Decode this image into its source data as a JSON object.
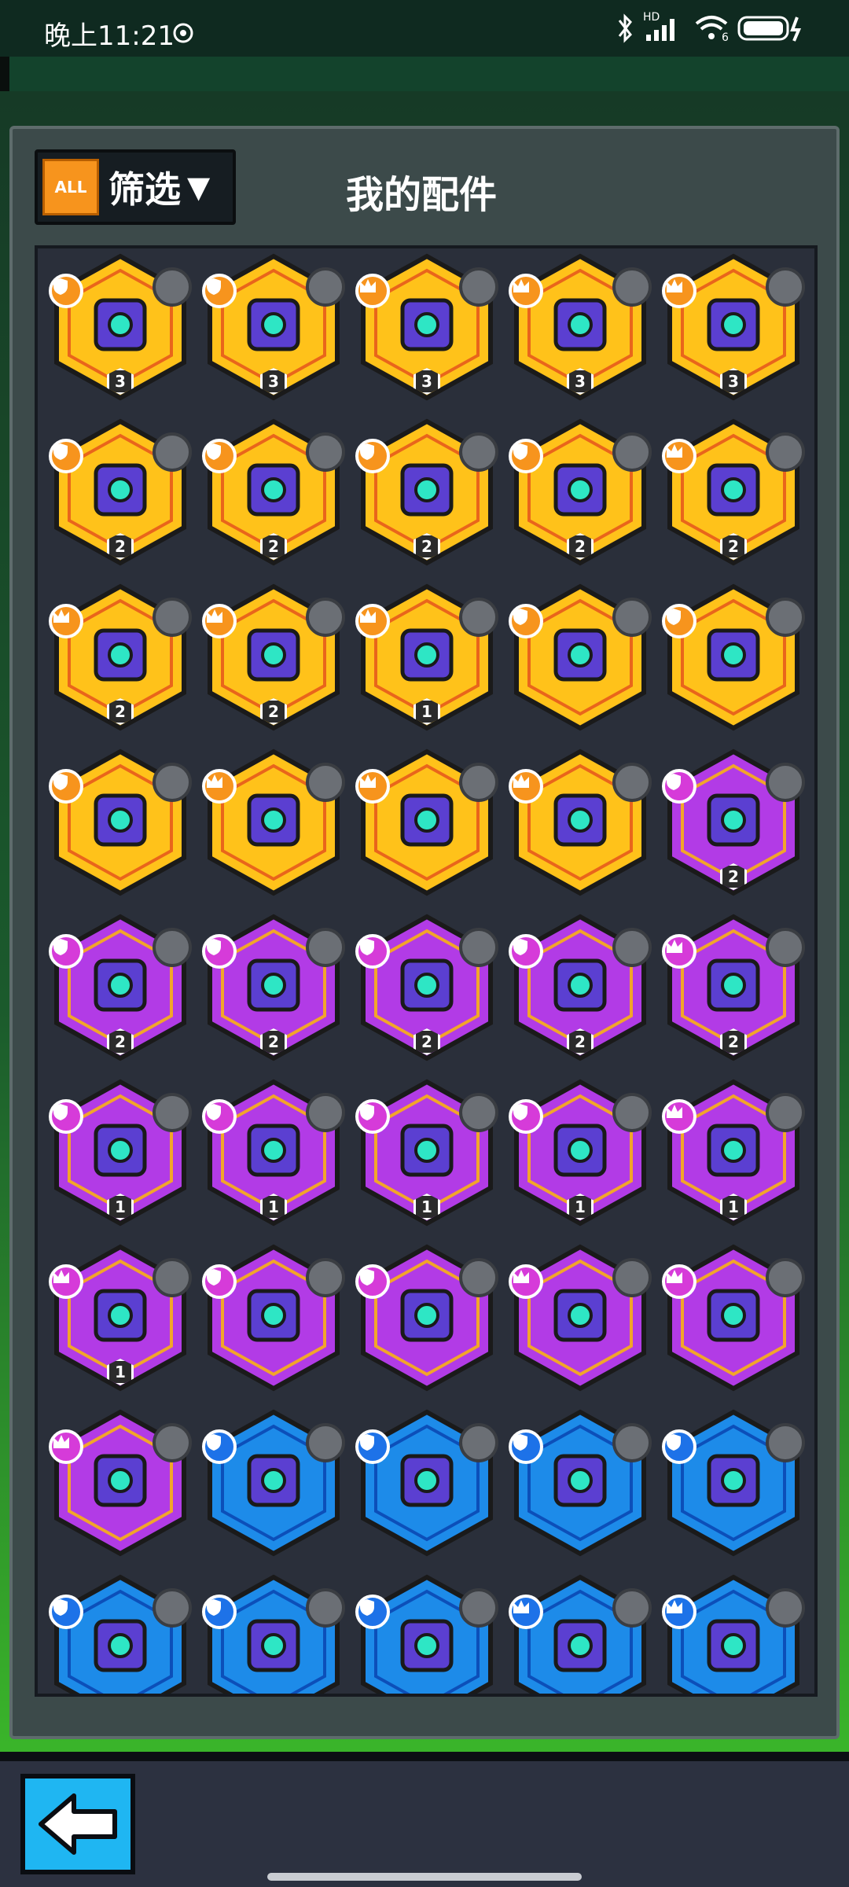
{
  "status_bar": {
    "time": "晚上11:21",
    "network": "HD",
    "wifi_label": "6"
  },
  "header": {
    "all_label": "ALL",
    "filter_label": "筛选",
    "filter_arrow": "▼",
    "title": "我的配件"
  },
  "colors": {
    "legendary": "#ffc21a",
    "legendary_border": "#e9651b",
    "epic": "#b23be6",
    "epic_border": "#f2a52a",
    "rare": "#1d8be9",
    "rare_border": "#0c4fb9"
  },
  "grid": {
    "rows": [
      [
        {
          "rarity": "legendary",
          "type": "shield",
          "level": "3"
        },
        {
          "rarity": "legendary",
          "type": "shield",
          "level": "3"
        },
        {
          "rarity": "legendary",
          "type": "crown",
          "level": "3"
        },
        {
          "rarity": "legendary",
          "type": "crown",
          "level": "3"
        },
        {
          "rarity": "legendary",
          "type": "crown",
          "level": "3"
        }
      ],
      [
        {
          "rarity": "legendary",
          "type": "shield",
          "level": "2"
        },
        {
          "rarity": "legendary",
          "type": "shield",
          "level": "2"
        },
        {
          "rarity": "legendary",
          "type": "shield",
          "level": "2"
        },
        {
          "rarity": "legendary",
          "type": "shield",
          "level": "2"
        },
        {
          "rarity": "legendary",
          "type": "crown",
          "level": "2"
        }
      ],
      [
        {
          "rarity": "legendary",
          "type": "crown",
          "level": "2"
        },
        {
          "rarity": "legendary",
          "type": "crown",
          "level": "2"
        },
        {
          "rarity": "legendary",
          "type": "crown",
          "level": "1"
        },
        {
          "rarity": "legendary",
          "type": "shield",
          "level": ""
        },
        {
          "rarity": "legendary",
          "type": "shield",
          "level": ""
        }
      ],
      [
        {
          "rarity": "legendary",
          "type": "shield",
          "level": ""
        },
        {
          "rarity": "legendary",
          "type": "crown",
          "level": ""
        },
        {
          "rarity": "legendary",
          "type": "crown",
          "level": ""
        },
        {
          "rarity": "legendary",
          "type": "crown",
          "level": ""
        },
        {
          "rarity": "epic",
          "type": "shield",
          "level": "2"
        }
      ],
      [
        {
          "rarity": "epic",
          "type": "shield",
          "level": "2"
        },
        {
          "rarity": "epic",
          "type": "shield",
          "level": "2"
        },
        {
          "rarity": "epic",
          "type": "shield",
          "level": "2"
        },
        {
          "rarity": "epic",
          "type": "shield",
          "level": "2"
        },
        {
          "rarity": "epic",
          "type": "crown",
          "level": "2"
        }
      ],
      [
        {
          "rarity": "epic",
          "type": "shield",
          "level": "1"
        },
        {
          "rarity": "epic",
          "type": "shield",
          "level": "1"
        },
        {
          "rarity": "epic",
          "type": "shield",
          "level": "1"
        },
        {
          "rarity": "epic",
          "type": "shield",
          "level": "1"
        },
        {
          "rarity": "epic",
          "type": "crown",
          "level": "1"
        }
      ],
      [
        {
          "rarity": "epic",
          "type": "crown",
          "level": "1"
        },
        {
          "rarity": "epic",
          "type": "shield",
          "level": ""
        },
        {
          "rarity": "epic",
          "type": "shield",
          "level": ""
        },
        {
          "rarity": "epic",
          "type": "crown",
          "level": ""
        },
        {
          "rarity": "epic",
          "type": "crown",
          "level": ""
        }
      ],
      [
        {
          "rarity": "epic",
          "type": "crown",
          "level": ""
        },
        {
          "rarity": "rare",
          "type": "shield",
          "level": ""
        },
        {
          "rarity": "rare",
          "type": "shield",
          "level": ""
        },
        {
          "rarity": "rare",
          "type": "shield",
          "level": ""
        },
        {
          "rarity": "rare",
          "type": "shield",
          "level": ""
        }
      ],
      [
        {
          "rarity": "rare",
          "type": "shield",
          "level": ""
        },
        {
          "rarity": "rare",
          "type": "shield",
          "level": ""
        },
        {
          "rarity": "rare",
          "type": "shield",
          "level": ""
        },
        {
          "rarity": "rare",
          "type": "crown",
          "level": ""
        },
        {
          "rarity": "rare",
          "type": "crown",
          "level": ""
        }
      ]
    ]
  },
  "bottom_bar": {
    "back_icon": "back-arrow-icon"
  }
}
